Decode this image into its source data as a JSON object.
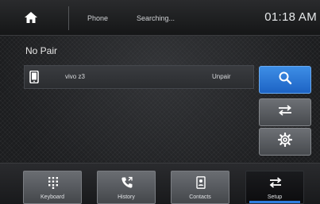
{
  "topbar": {
    "phone_label": "Phone",
    "status_label": "Searching...",
    "clock": "01:18 AM"
  },
  "pairing": {
    "status_text": "No Pair",
    "device_name": "vivo z3",
    "unpair_label": "Unpair"
  },
  "nav": {
    "items": [
      {
        "label": "Keyboard",
        "icon": "keypad-icon"
      },
      {
        "label": "History",
        "icon": "call-history-icon"
      },
      {
        "label": "Contacts",
        "icon": "contacts-icon"
      },
      {
        "label": "Setup",
        "icon": "swap-arrows-icon",
        "active": true
      }
    ]
  },
  "colors": {
    "accent_blue": "#2f7fe0",
    "search_button": "#2a74d6",
    "background": "#1c1d1f"
  }
}
